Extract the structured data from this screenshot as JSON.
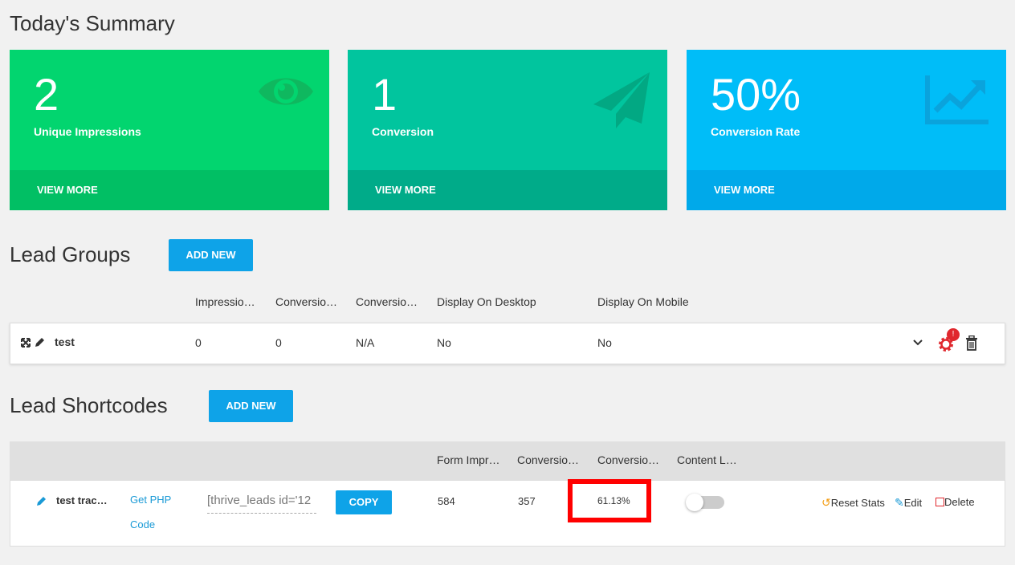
{
  "summary": {
    "title": "Today's Summary",
    "cards": [
      {
        "value": "2",
        "label": "Unique Impressions",
        "footer": "VIEW MORE",
        "icon": "eye-icon",
        "color": "#02d56f",
        "footer_color": "#01bf64"
      },
      {
        "value": "1",
        "label": "Conversion",
        "footer": "VIEW MORE",
        "icon": "paper-plane-icon",
        "color": "#01c59e",
        "footer_color": "#00ab89"
      },
      {
        "value": "50%",
        "label": "Conversion Rate",
        "footer": "VIEW MORE",
        "icon": "trending-chart-icon",
        "color": "#00bdf8",
        "footer_color": "#00a9ea"
      }
    ]
  },
  "lead_groups": {
    "title": "Lead Groups",
    "add_label": "ADD NEW",
    "headers": [
      "Impressio…",
      "Conversio…",
      "Conversio…",
      "Display On Desktop",
      "Display On Mobile"
    ],
    "rows": [
      {
        "name": "test",
        "impressions": "0",
        "conversions": "0",
        "rate": "N/A",
        "desktop": "No",
        "mobile": "No",
        "badge": "!"
      }
    ]
  },
  "lead_shortcodes": {
    "title": "Lead Shortcodes",
    "add_label": "ADD NEW",
    "headers": [
      "Form Impr…",
      "Conversio…",
      "Conversio…",
      "Content L…"
    ],
    "rows": [
      {
        "name": "test trac…",
        "php_link_line1": "Get PHP",
        "php_link_line2": "Code",
        "shortcode": "[thrive_leads id='12",
        "copy_label": "COPY",
        "impressions": "584",
        "conversions": "357",
        "rate": "61.13%",
        "reset_label": "Reset Stats",
        "edit_label": "Edit",
        "delete_label": "Delete"
      }
    ]
  },
  "colors": {
    "accent_blue": "#0ea3e8",
    "highlight": "#ff0000",
    "alert_red": "#e0282e"
  }
}
